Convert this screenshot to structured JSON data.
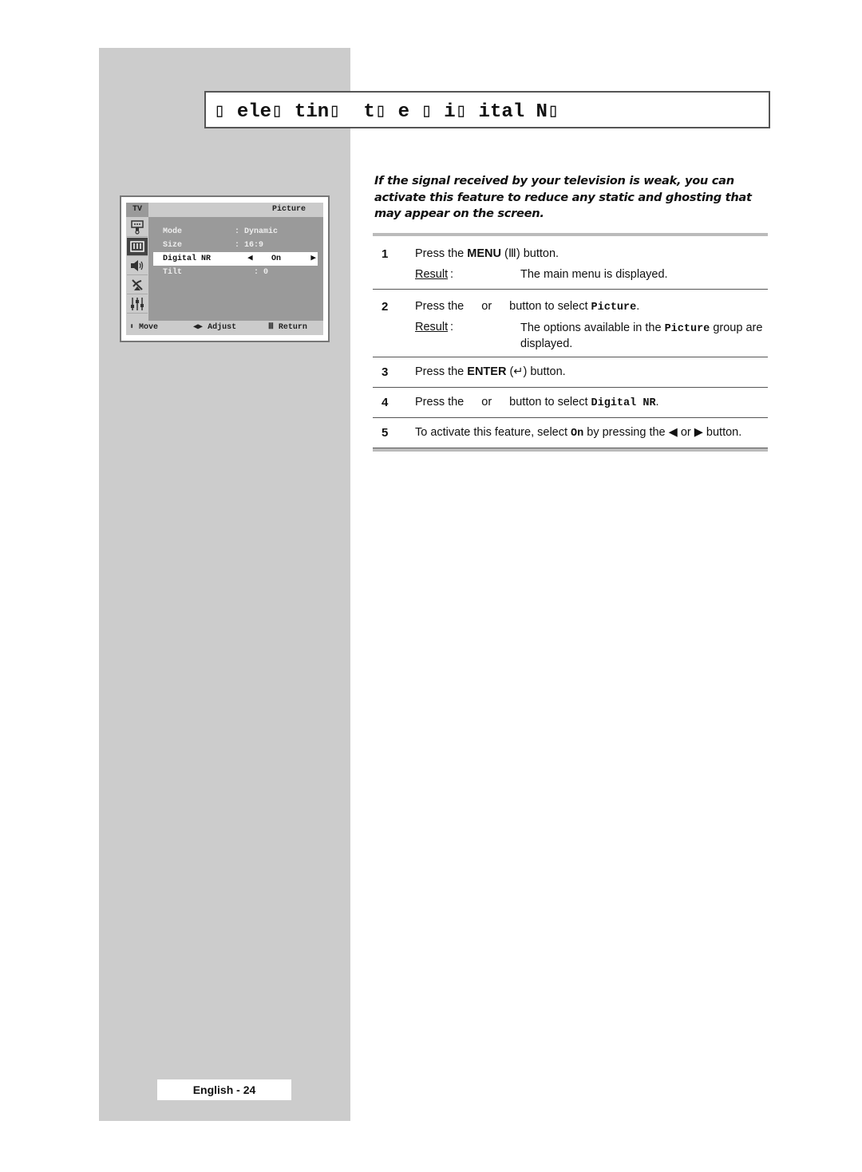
{
  "page": {
    "title": "▯ ele▯ tin▯  t▯ e ▯ i▯ ital N▯",
    "intro": "If the signal received by your television is weak, you can activate this feature to reduce any static and ghosting that may appear on the screen.",
    "footer": "English - 24"
  },
  "osd": {
    "source": "TV",
    "menu_title": "Picture",
    "side_icons": [
      "input-icon",
      "picture-icon",
      "sound-icon",
      "channel-icon",
      "setup-icon"
    ],
    "active_icon": "picture-icon",
    "rows": [
      {
        "label": "Mode",
        "value": ": Dynamic"
      },
      {
        "label": "Size",
        "value": ": 16:9"
      },
      {
        "label": "Digital NR",
        "value": "On",
        "selected": true
      },
      {
        "label": "Tilt",
        "value": ": 0"
      }
    ],
    "footer": {
      "move": "Move",
      "adjust": "Adjust",
      "return": "Return"
    }
  },
  "steps": [
    {
      "num": "1",
      "pre": "Press the ",
      "bold": "MENU",
      "post": " button.",
      "result_label": "Result",
      "result": "The main menu is displayed."
    },
    {
      "num": "2",
      "pre": "Press the",
      "mid": "or",
      "post": "button to select ",
      "mono": "Picture",
      "end": ".",
      "result_label": "Result",
      "result_pre": "The options available in the ",
      "result_mono": "Picture",
      "result_post": " group are displayed."
    },
    {
      "num": "3",
      "pre": "Press the ",
      "bold": "ENTER",
      "post": " button."
    },
    {
      "num": "4",
      "pre": "Press the",
      "mid": "or",
      "post": "button to select ",
      "mono": "Digital NR",
      "end": "."
    },
    {
      "num": "5",
      "pre": "To activate this feature, select ",
      "mono": "On",
      "post": " by pressing the ◀ or ▶ button."
    }
  ]
}
